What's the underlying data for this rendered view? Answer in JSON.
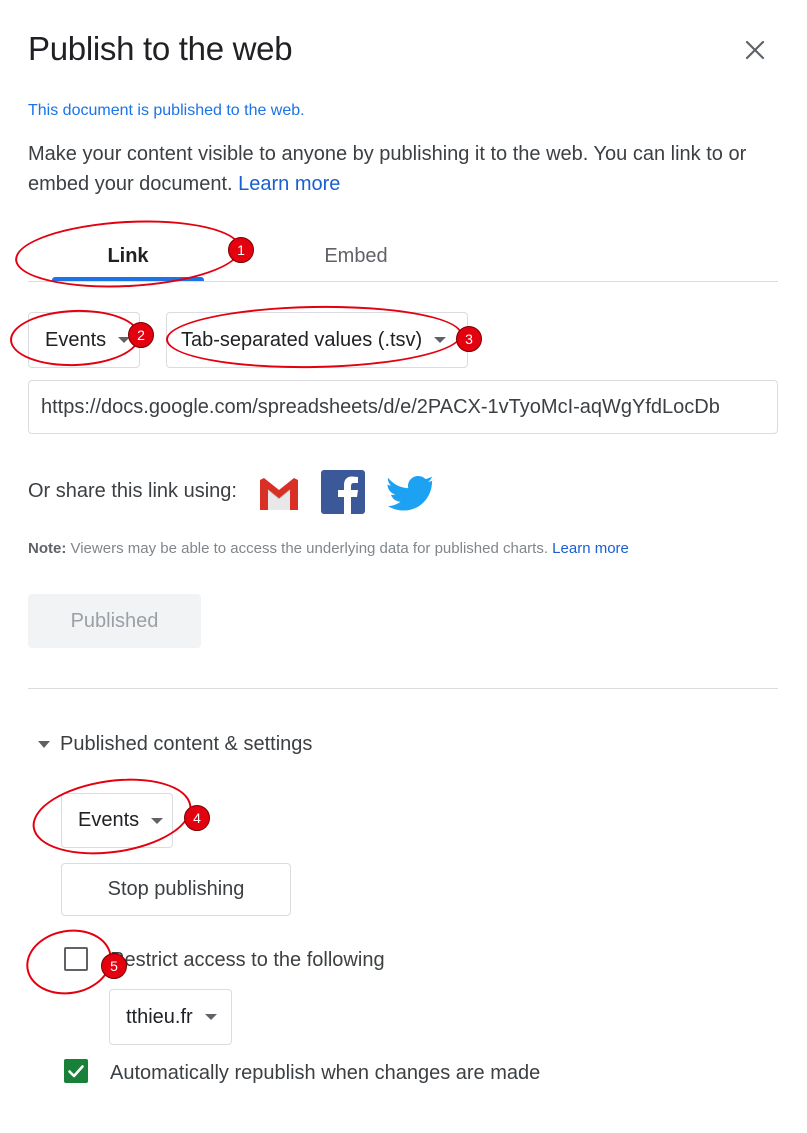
{
  "dialog": {
    "title": "Publish to the web",
    "status": "This document is published to the web.",
    "description": "Make your content visible to anyone by publishing it to the web. You can link to or embed your document.",
    "learn_more": "Learn more"
  },
  "tabs": [
    {
      "label": "Link",
      "active": true
    },
    {
      "label": "Embed",
      "active": false
    }
  ],
  "link": {
    "sheet_select": "Events",
    "format_select": "Tab-separated values (.tsv)",
    "url": "https://docs.google.com/spreadsheets/d/e/2PACX-1vTyoMcI-aqWgYfdLocDb",
    "share_label": "Or share this link using:",
    "share_icons": [
      "gmail-icon",
      "facebook-icon",
      "twitter-icon"
    ],
    "note_label": "Note:",
    "note_text": " Viewers may be able to access the underlying data for published charts. ",
    "note_link": "Learn more",
    "published_button": "Published"
  },
  "settings": {
    "section_label": "Published content & settings",
    "sheet_select": "Events",
    "stop_button": "Stop publishing",
    "restrict_label": "Restrict access to the following",
    "restrict_checked": false,
    "domain_select": "tthieu.fr",
    "auto_republish_label": "Automatically republish when changes are made",
    "auto_republish_checked": true
  },
  "annotations": [
    "1",
    "2",
    "3",
    "4",
    "5"
  ],
  "colors": {
    "accent": "#1a73e8",
    "annotation": "#e3000f",
    "check": "#188038"
  }
}
